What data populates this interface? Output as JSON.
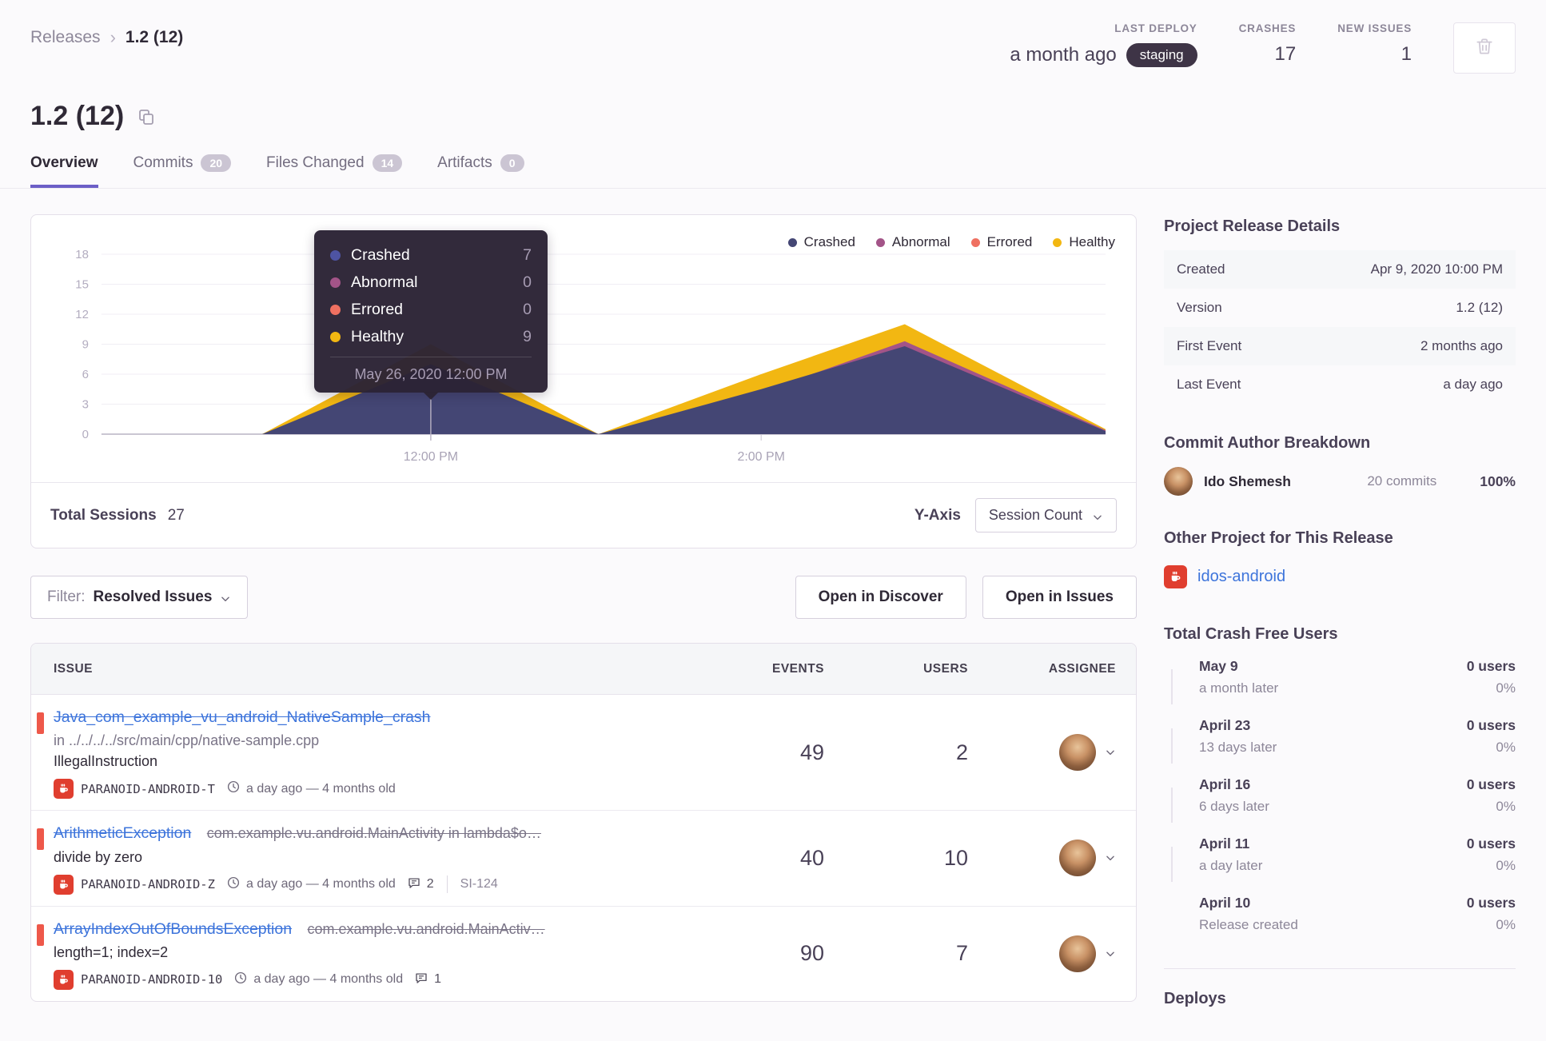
{
  "breadcrumb": {
    "parent": "Releases",
    "separator": "›",
    "current": "1.2 (12)"
  },
  "header_stats": {
    "last_deploy": {
      "label": "LAST DEPLOY",
      "value": "a month ago",
      "environment": "staging"
    },
    "crashes": {
      "label": "CRASHES",
      "value": "17"
    },
    "new_issues": {
      "label": "NEW ISSUES",
      "value": "1"
    }
  },
  "page_title": "1.2 (12)",
  "tabs": [
    {
      "label": "Overview",
      "active": true
    },
    {
      "label": "Commits",
      "badge": "20"
    },
    {
      "label": "Files Changed",
      "badge": "14"
    },
    {
      "label": "Artifacts",
      "badge": "0"
    }
  ],
  "chart_card": {
    "legend": [
      {
        "label": "Crashed",
        "color": "#444674"
      },
      {
        "label": "Abnormal",
        "color": "#a35488"
      },
      {
        "label": "Errored",
        "color": "#ef7061"
      },
      {
        "label": "Healthy",
        "color": "#f2b712"
      }
    ],
    "tooltip": {
      "rows": [
        {
          "label": "Crashed",
          "value": "7",
          "color": "#4e54a3"
        },
        {
          "label": "Abnormal",
          "value": "0",
          "color": "#a35488"
        },
        {
          "label": "Errored",
          "value": "0",
          "color": "#ef7061"
        },
        {
          "label": "Healthy",
          "value": "9",
          "color": "#f2b712"
        }
      ],
      "date": "May 26, 2020 12:00 PM"
    },
    "footer": {
      "total_sessions_label": "Total Sessions",
      "total_sessions_value": "27",
      "y_axis_label": "Y-Axis",
      "y_axis_value": "Session Count"
    }
  },
  "chart_data": {
    "type": "area",
    "title": "Release session health over time",
    "grid": true,
    "legend_position": "top-right",
    "legend_entries": [
      "Crashed",
      "Abnormal",
      "Errored",
      "Healthy"
    ],
    "y_ticks": [
      0,
      3,
      6,
      9,
      12,
      15,
      18
    ],
    "ylim": [
      0,
      19.5
    ],
    "x_tick_labels": [
      {
        "label": "12:00 PM",
        "f": 0.328
      },
      {
        "label": "2:00 PM",
        "f": 0.657
      }
    ],
    "hover_point": {
      "time": "May 26, 2020 12:00 PM",
      "f": 0.328,
      "crashed": 7,
      "abnormal": 0,
      "errored": 0,
      "healthy": 9
    },
    "total_sessions": 27,
    "series": [
      {
        "name": "Healthy",
        "color": "#f2b712",
        "points": [
          [
            0,
            0
          ],
          [
            0.16,
            0
          ],
          [
            0.328,
            9
          ],
          [
            0.495,
            0
          ],
          [
            0.657,
            6
          ],
          [
            0.8,
            11
          ],
          [
            1,
            0.5
          ]
        ]
      },
      {
        "name": "Abnormal",
        "color": "#a35488",
        "points": [
          [
            0,
            0
          ],
          [
            0.16,
            0
          ],
          [
            0.328,
            0
          ],
          [
            0.495,
            0
          ],
          [
            0.657,
            4.2
          ],
          [
            0.8,
            9.3
          ],
          [
            1,
            0.4
          ]
        ]
      },
      {
        "name": "Errored",
        "color": "#ef7061",
        "points": [
          [
            0,
            0
          ],
          [
            1,
            0
          ]
        ]
      },
      {
        "name": "Crashed",
        "color": "#444674",
        "points": [
          [
            0,
            0
          ],
          [
            0.16,
            0
          ],
          [
            0.328,
            7
          ],
          [
            0.495,
            0
          ],
          [
            0.657,
            4.5
          ],
          [
            0.8,
            8.8
          ],
          [
            1,
            0.3
          ]
        ]
      }
    ]
  },
  "filter_bar": {
    "filter_label": "Filter:",
    "filter_value": "Resolved Issues",
    "open_in_discover": "Open in Discover",
    "open_in_issues": "Open in Issues"
  },
  "issues_table": {
    "columns": [
      "ISSUE",
      "EVENTS",
      "USERS",
      "ASSIGNEE"
    ],
    "rows": [
      {
        "title": "Java_com_example_vu_android_NativeSample_crash",
        "location": "in ../../../../src/main/cpp/native-sample.cpp",
        "message": "IllegalInstruction",
        "project": "PARANOID-ANDROID-T",
        "age": "a day ago — 4 months old",
        "events": "49",
        "users": "2"
      },
      {
        "title": "ArithmeticException",
        "culprit": "com.example.vu.android.MainActivity in lambda$o…",
        "message": "divide by zero",
        "project": "PARANOID-ANDROID-Z",
        "age": "a day ago — 4 months old",
        "comments": "2",
        "short_id": "SI-124",
        "events": "40",
        "users": "10"
      },
      {
        "title": "ArrayIndexOutOfBoundsException",
        "culprit": "com.example.vu.android.MainActiv…",
        "message": "length=1; index=2",
        "project": "PARANOID-ANDROID-10",
        "age": "a day ago — 4 months old",
        "comments": "1",
        "events": "90",
        "users": "7"
      }
    ]
  },
  "sidebar": {
    "release_details": {
      "heading": "Project Release Details",
      "rows": [
        {
          "label": "Created",
          "value": "Apr 9, 2020 10:00 PM"
        },
        {
          "label": "Version",
          "value": "1.2 (12)"
        },
        {
          "label": "First Event",
          "value": "2 months ago"
        },
        {
          "label": "Last Event",
          "value": "a day ago"
        }
      ]
    },
    "commit_authors": {
      "heading": "Commit Author Breakdown",
      "author": "Ido Shemesh",
      "commits": "20 commits",
      "percent": "100%"
    },
    "other_project": {
      "heading": "Other Project for This Release",
      "project": "idos-android"
    },
    "crash_free": {
      "heading": "Total Crash Free Users",
      "items": [
        {
          "date": "May 9",
          "relative": "a month later",
          "users": "0 users",
          "percent": "0%"
        },
        {
          "date": "April 23",
          "relative": "13 days later",
          "users": "0 users",
          "percent": "0%"
        },
        {
          "date": "April 16",
          "relative": "6 days later",
          "users": "0 users",
          "percent": "0%"
        },
        {
          "date": "April 11",
          "relative": "a day later",
          "users": "0 users",
          "percent": "0%"
        },
        {
          "date": "April 10",
          "relative": "Release created",
          "users": "0 users",
          "percent": "0%"
        }
      ]
    },
    "deploys_heading": "Deploys"
  }
}
